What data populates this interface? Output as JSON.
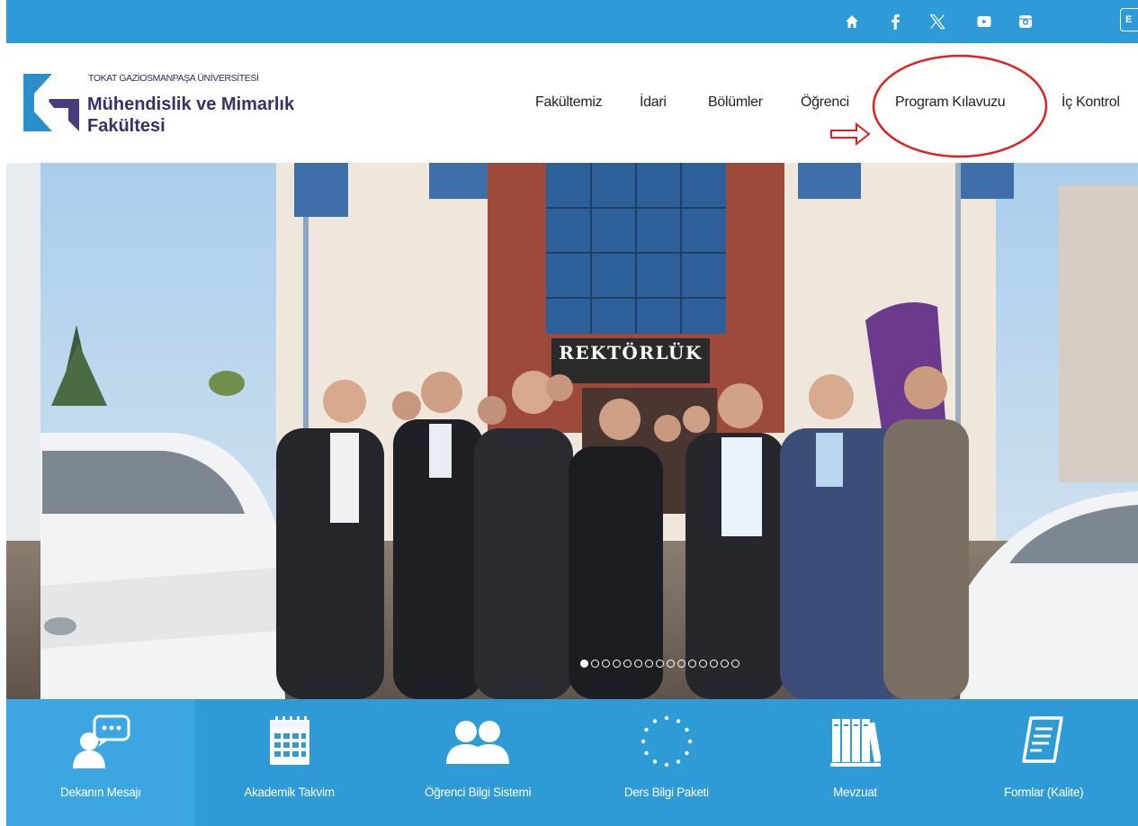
{
  "topbar": {
    "background": "#2f9ad8",
    "icons": [
      "home-icon",
      "facebook-icon",
      "x-icon",
      "youtube-icon",
      "instagram-icon"
    ],
    "language_button": "E"
  },
  "logo": {
    "university": "TOKAT GAZİOSMANPAŞA ÜNİVERSİTESİ",
    "faculty": "Mühendislik ve Mimarlık Fakültesi"
  },
  "nav": {
    "items": [
      "Fakültemiz",
      "İdari",
      "Bölümler",
      "Öğrenci",
      "Program Kılavuzu",
      "İç Kontrol"
    ]
  },
  "annotation": {
    "color": "#e02020",
    "shapes": [
      "red-arrow",
      "red-ellipse"
    ]
  },
  "hero": {
    "signage": "REKTÖRLÜK",
    "slide_count": 15,
    "active_slide": 1
  },
  "tiles": {
    "background": "#2e9ad6",
    "items": [
      {
        "label": "Dekanın Mesajı",
        "icon": "chat-person-icon"
      },
      {
        "label": "Akademik Takvim",
        "icon": "calendar-icon"
      },
      {
        "label": "Öğrenci Bilgi Sistemi",
        "icon": "users-icon"
      },
      {
        "label": "Ders Bilgi Paketi",
        "icon": "eu-stars-icon"
      },
      {
        "label": "Mevzuat",
        "icon": "books-icon"
      },
      {
        "label": "Formlar (Kalite)",
        "icon": "document-icon"
      }
    ]
  }
}
